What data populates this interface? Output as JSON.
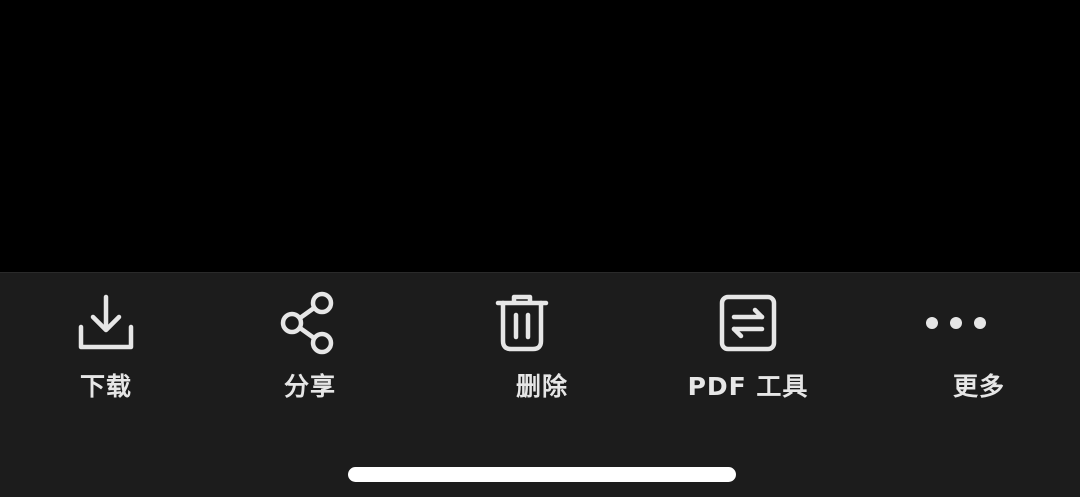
{
  "toolbar": {
    "items": [
      {
        "label": "下载",
        "icon": "download-icon"
      },
      {
        "label": "分享",
        "icon": "share-icon"
      },
      {
        "label": "删除",
        "icon": "trash-icon"
      },
      {
        "label": "PDF 工具",
        "icon": "pdf-convert-icon"
      },
      {
        "label": "更多",
        "icon": "more-icon"
      }
    ]
  },
  "colors": {
    "background": "#000000",
    "toolbar_background": "#1c1c1c",
    "icon_and_label": "#e6e6e6",
    "home_indicator": "#ffffff"
  }
}
